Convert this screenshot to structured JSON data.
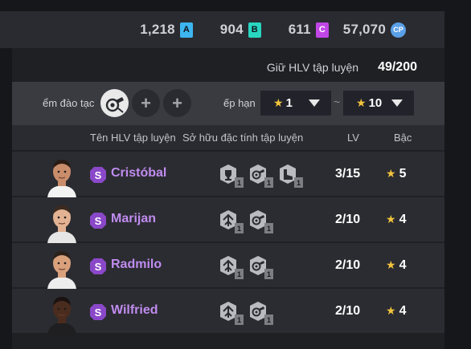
{
  "currencies": [
    {
      "value": "1,218",
      "badge": "A",
      "color": "#3db5f0"
    },
    {
      "value": "904",
      "badge": "B",
      "color": "#29d6c0"
    },
    {
      "value": "611",
      "badge": "C",
      "color": "#c046e6"
    },
    {
      "value": "57,070",
      "badge": "CP",
      "color": "#5aa0e8"
    }
  ],
  "coach_count": {
    "label": "Giữ HLV tập luyện",
    "value": "49/200"
  },
  "filters": {
    "slot_label": "ểm đào tạc",
    "rank_label": "ếp hạn",
    "rank_min": "1",
    "rank_max": "10",
    "separator": "~"
  },
  "columns": {
    "name": "Tên HLV tập luyện",
    "traits": "Sở hữu đặc tính tập luyện",
    "level": "LV",
    "rank": "Bậc"
  },
  "coaches": [
    {
      "badge": "S",
      "name": "Cristóbal",
      "traits": [
        "trophy-trait-icon",
        "whistle-trait-icon",
        "boot-trait-icon"
      ],
      "trait_levels": [
        "1",
        "1",
        "1"
      ],
      "lv": "3/15",
      "rank": "5"
    },
    {
      "badge": "S",
      "name": "Marijan",
      "traits": [
        "arrows-trait-icon",
        "whistle-trait-icon"
      ],
      "trait_levels": [
        "1",
        "1"
      ],
      "lv": "2/10",
      "rank": "4"
    },
    {
      "badge": "S",
      "name": "Radmilo",
      "traits": [
        "arrows-trait-icon",
        "whistle-trait-icon"
      ],
      "trait_levels": [
        "1",
        "1"
      ],
      "lv": "2/10",
      "rank": "4"
    },
    {
      "badge": "S",
      "name": "Wilfried",
      "traits": [
        "arrows-trait-icon",
        "whistle-trait-icon"
      ],
      "trait_levels": [
        "1",
        "1"
      ],
      "lv": "2/10",
      "rank": "4"
    }
  ],
  "star_char": "★"
}
